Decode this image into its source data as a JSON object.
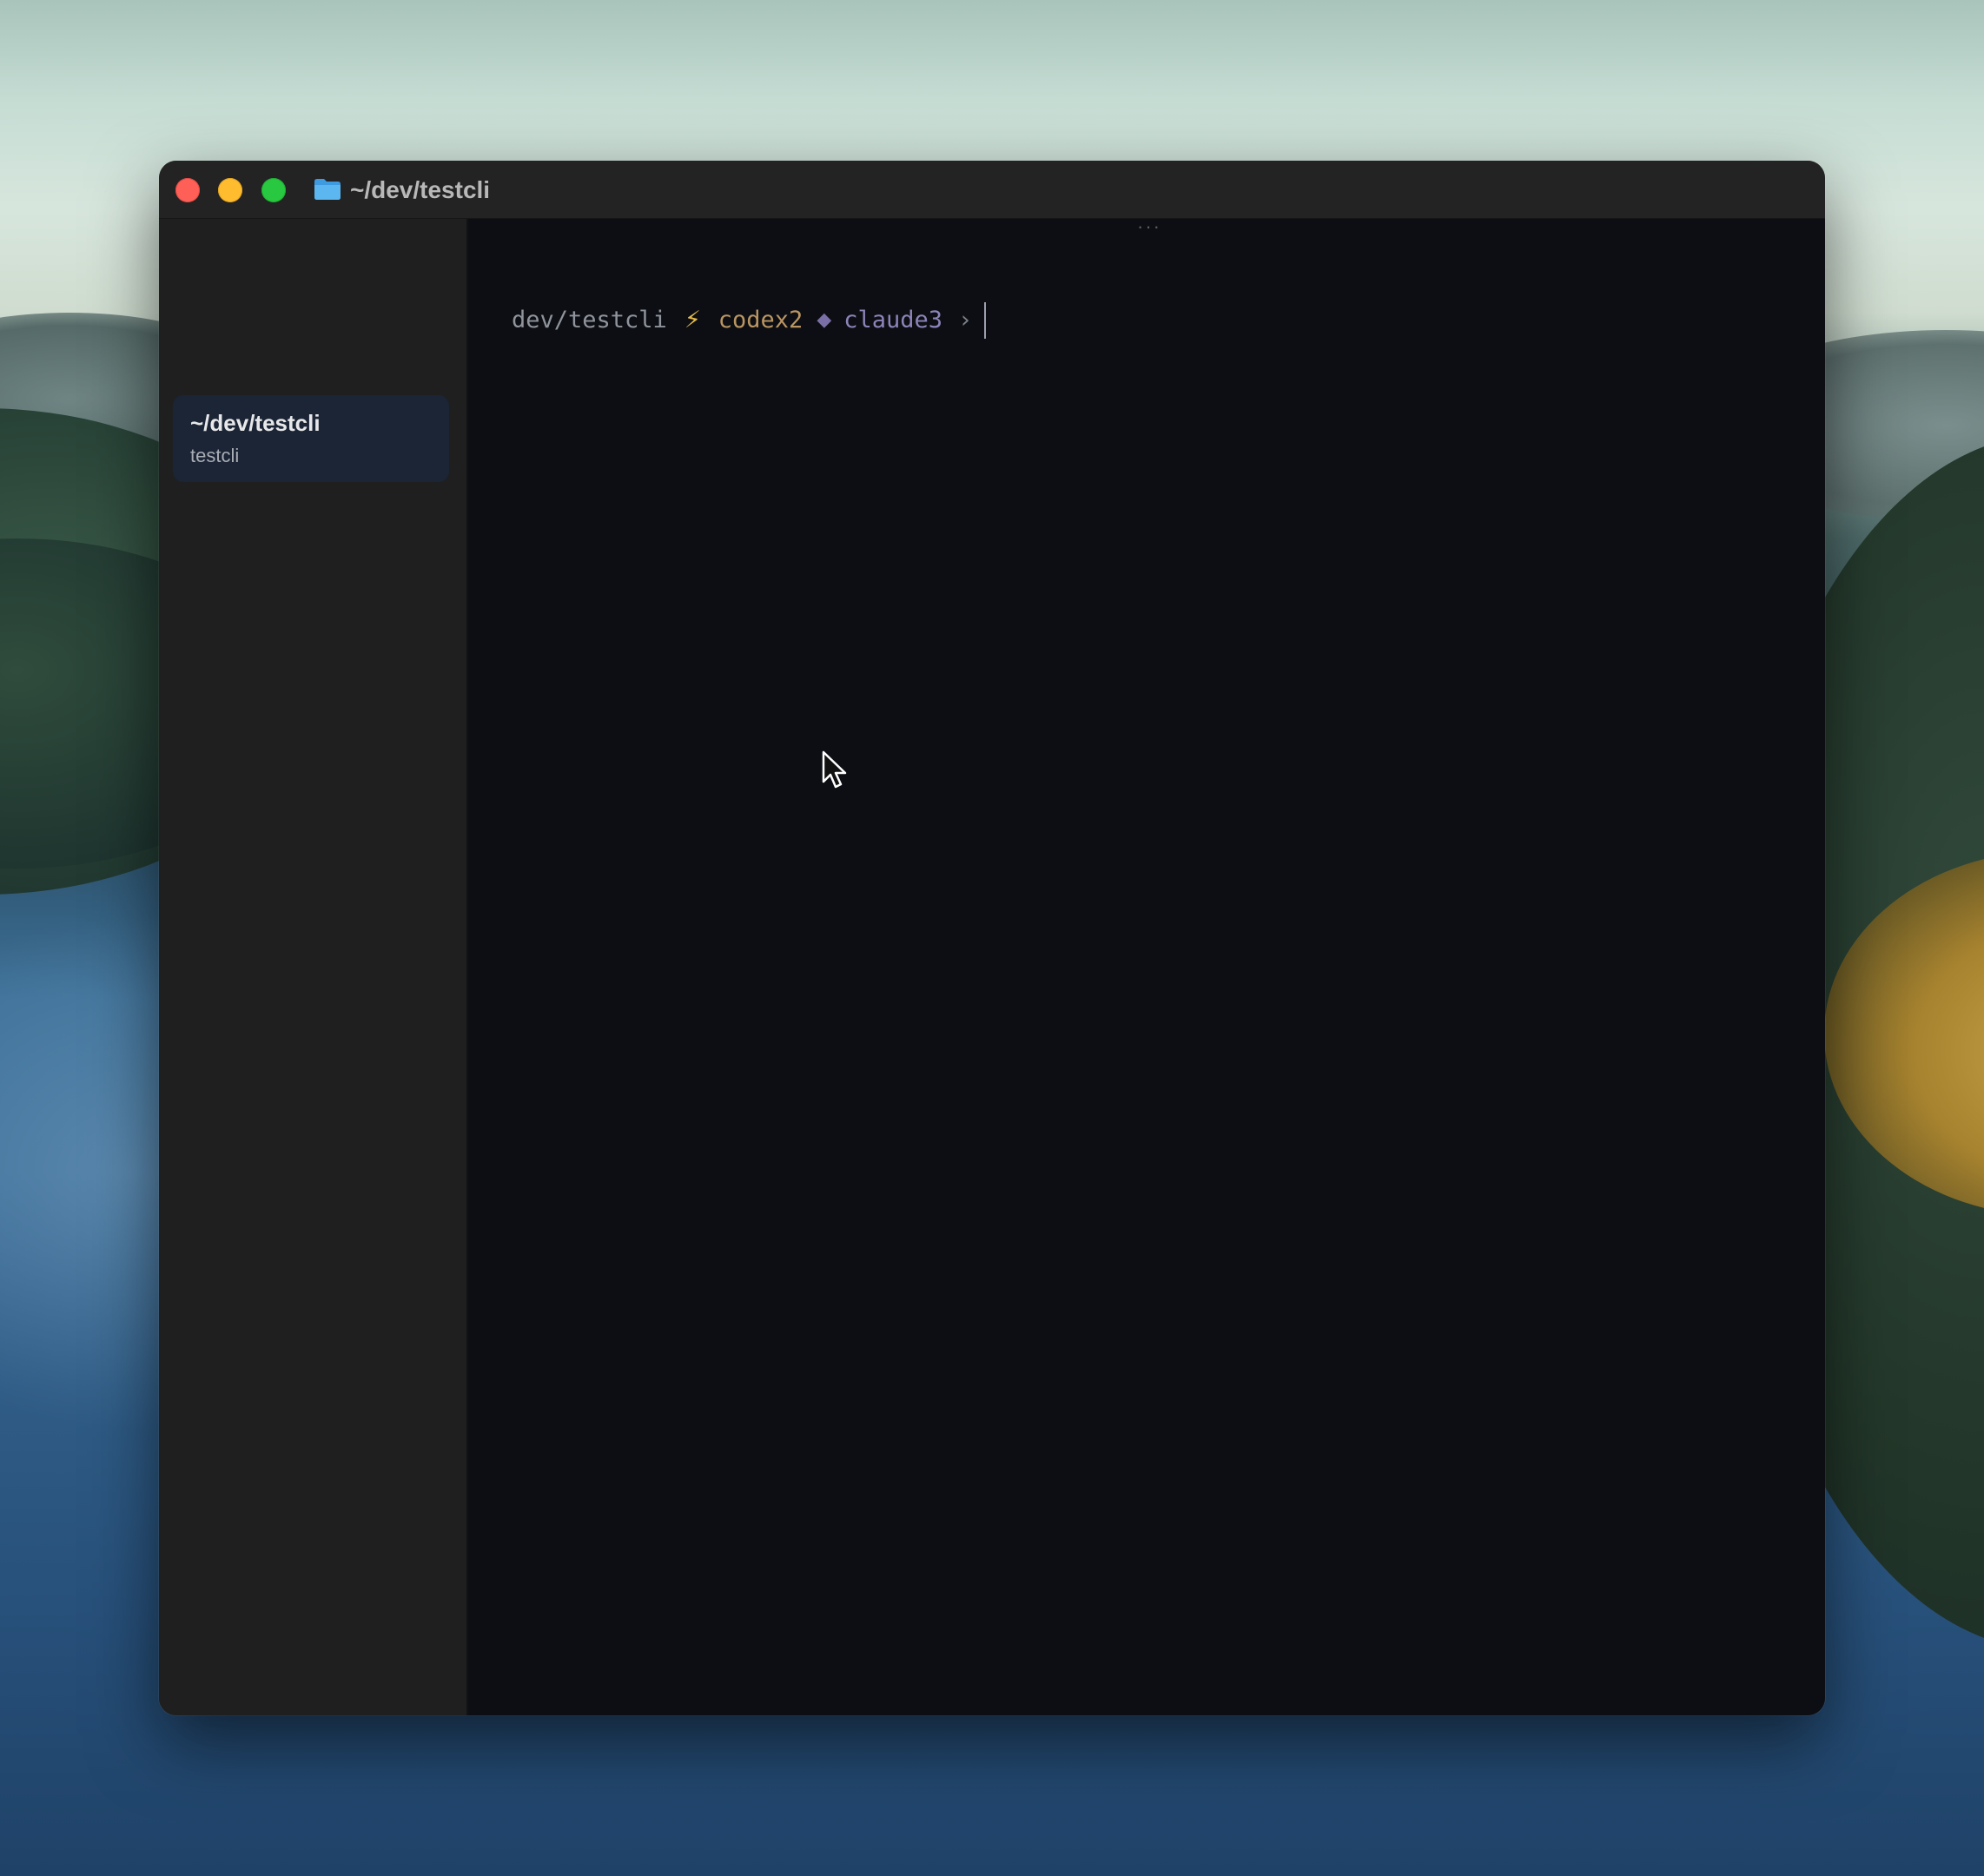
{
  "window": {
    "title": "~/dev/testcli",
    "title_icon": "folder-icon"
  },
  "sidebar": {
    "items": [
      {
        "title": "~/dev/testcli",
        "subtitle": "testcli",
        "selected": true
      }
    ]
  },
  "terminal": {
    "drag_handle": "···",
    "prompt": {
      "directory": "dev/testcli",
      "bolt": "⚡",
      "agent_1": "codex2",
      "separator": "◆",
      "agent_2": "claude3",
      "chevron": "›"
    }
  },
  "colors": {
    "close": "#fe5f57",
    "minimize": "#febc2e",
    "zoom": "#28c840",
    "sidebar_selected_bg": "#1b2535",
    "terminal_bg": "#0c0e13",
    "folder_icon": "#4aa8e8",
    "prompt_dir": "#8f949c",
    "prompt_bolt": "#e6b94a",
    "prompt_agent_1": "#b99562",
    "prompt_separator": "#7b6fa8",
    "prompt_agent_2": "#8c83b8"
  }
}
